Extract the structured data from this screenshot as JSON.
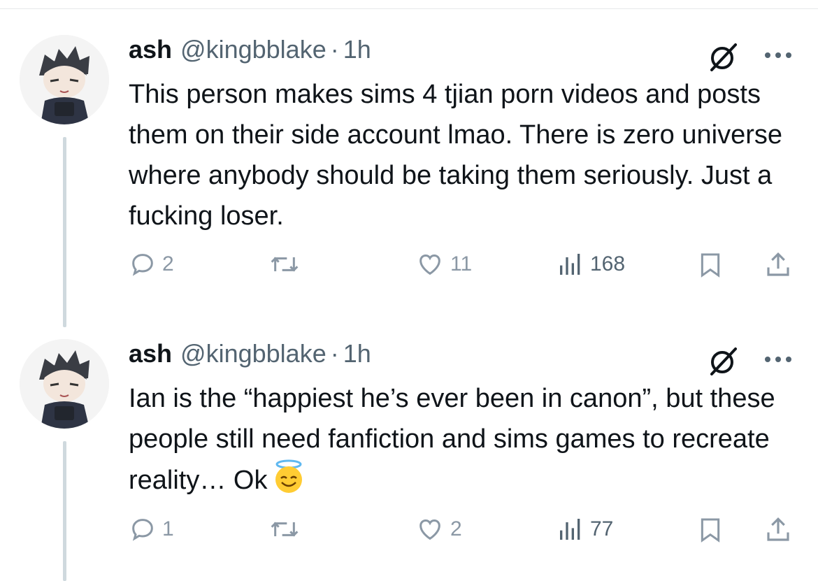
{
  "tweets": [
    {
      "name": "ash",
      "handle": "@kingbblake",
      "separator": "·",
      "time": "1h",
      "text": "This person makes sims 4 tjian porn videos and posts them on their side account lmao. There is zero universe where anybody should be taking them seriously. Just a fucking loser.",
      "emoji": "",
      "replies": "2",
      "likes": "11",
      "views": "168"
    },
    {
      "name": "ash",
      "handle": "@kingbblake",
      "separator": "·",
      "time": "1h",
      "text": "Ian is the “happiest he’s ever been in canon”, but these people still need fanfiction and sims games to recreate reality… Ok",
      "emoji": "smiling-face-with-halo",
      "replies": "1",
      "likes": "2",
      "views": "77"
    }
  ],
  "colors": {
    "text": "#0f1419",
    "secondary": "#536471",
    "muted_icon": "#8b98a5",
    "thread_line": "#cfd9de"
  },
  "icons": [
    "reply-icon",
    "retweet-icon",
    "like-icon",
    "views-icon",
    "bookmark-icon",
    "share-icon",
    "grok-icon",
    "more-icon"
  ]
}
